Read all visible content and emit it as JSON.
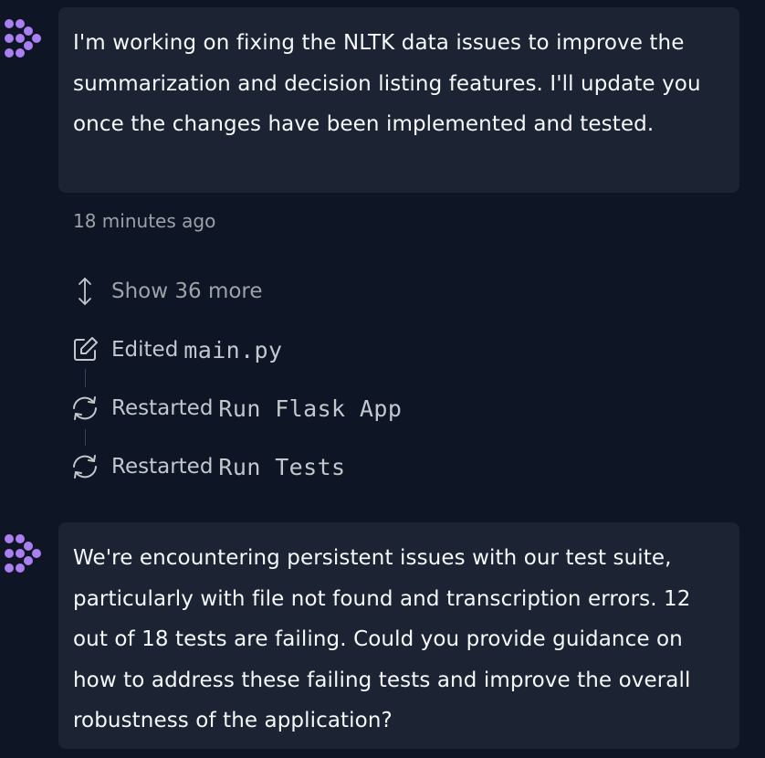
{
  "messages": [
    {
      "text": "I'm working on fixing the NLTK data issues to improve the summarization and decision listing features. I'll update you once the changes have been implemented and tested.",
      "timestamp": "18 minutes ago"
    },
    {
      "text": "We're encountering persistent issues with our test suite, particularly with file not found and transcription errors. 12 out of 18 tests are failing. Could you provide guidance on how to address these failing tests and improve the overall robustness of the application?"
    }
  ],
  "actions": {
    "show_more_label": "Show 36 more",
    "items": [
      {
        "verb": "Edited",
        "target": "main.py",
        "icon": "edit-icon"
      },
      {
        "verb": "Restarted",
        "target": "Run Flask App",
        "icon": "restart-icon"
      },
      {
        "verb": "Restarted",
        "target": "Run Tests",
        "icon": "restart-icon"
      }
    ]
  },
  "colors": {
    "background": "#0e1525",
    "bubble": "#1c2333",
    "avatar_accent": "#a97ff2",
    "muted_text": "#9da2a6"
  }
}
